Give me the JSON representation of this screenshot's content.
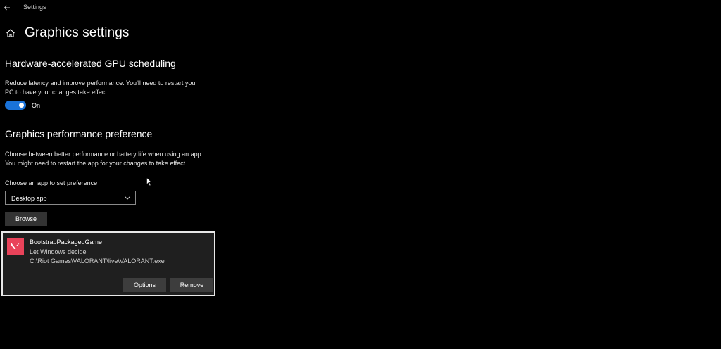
{
  "window": {
    "app_title": "Settings",
    "back_icon": "back-arrow-icon"
  },
  "header": {
    "home_icon": "home-icon",
    "title": "Graphics settings"
  },
  "gpu_scheduling": {
    "title": "Hardware-accelerated GPU scheduling",
    "description_line1": "Reduce latency and improve performance. You'll need to restart your",
    "description_line2": "PC to have your changes take effect.",
    "toggle_state": "On",
    "toggle_color": "#1a73d9"
  },
  "performance_pref": {
    "title": "Graphics performance preference",
    "description_line1": "Choose between better performance or battery life when using an app.",
    "description_line2": "You might need to restart the app for your changes to take effect.",
    "choose_label": "Choose an app to set preference",
    "dropdown_value": "Desktop app",
    "browse_label": "Browse"
  },
  "app_entry": {
    "name": "BootstrapPackagedGame",
    "preference": "Let Windows decide",
    "path": "C:\\Riot Games\\VALORANT\\live\\VALORANT.exe",
    "icon_color": "#e9435a",
    "options_label": "Options",
    "remove_label": "Remove"
  }
}
